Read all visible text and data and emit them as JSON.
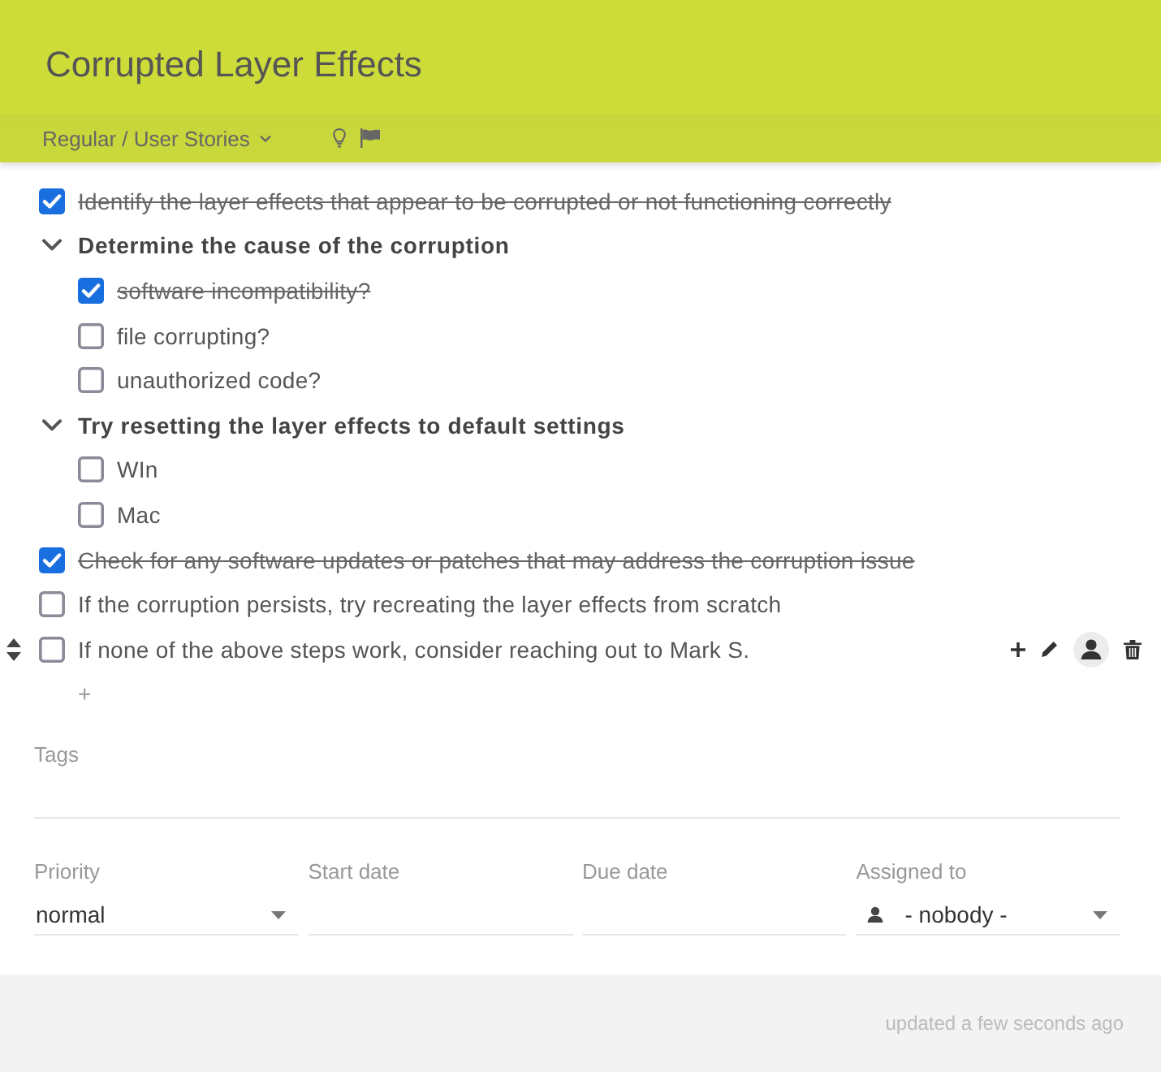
{
  "header": {
    "title": "Corrupted Layer Effects",
    "project": "Regular / User Stories"
  },
  "checklist": [
    {
      "kind": "item",
      "label": "Identify the layer effects that appear to be corrupted or not functioning correctly",
      "checked": true,
      "hovered": false
    },
    {
      "kind": "group",
      "label": "Determine the cause of the corruption",
      "expanded": true,
      "hovered": false,
      "children": [
        {
          "kind": "item",
          "label": "software incompatibility?",
          "checked": true,
          "hovered": false
        },
        {
          "kind": "item",
          "label": "file corrupting?",
          "checked": false,
          "hovered": false
        },
        {
          "kind": "item",
          "label": "unauthorized code?",
          "checked": false,
          "hovered": false
        }
      ]
    },
    {
      "kind": "group",
      "label": "Try resetting the layer effects to default settings",
      "expanded": true,
      "hovered": false,
      "children": [
        {
          "kind": "item",
          "label": "WIn",
          "checked": false,
          "hovered": false
        },
        {
          "kind": "item",
          "label": "Mac",
          "checked": false,
          "hovered": false
        }
      ]
    },
    {
      "kind": "item",
      "label": "Check for any software updates or patches that may address the corruption issue",
      "checked": true,
      "hovered": false
    },
    {
      "kind": "item",
      "label": "If the corruption persists, try recreating the layer effects from scratch",
      "checked": false,
      "hovered": false
    },
    {
      "kind": "item",
      "label": "If none of the above steps work, consider reaching out to Mark S.",
      "checked": false,
      "hovered": true
    }
  ],
  "add_item": "+",
  "tags": {
    "label": "Tags"
  },
  "fields": [
    {
      "kind": "select",
      "label": "Priority",
      "value": "normal"
    },
    {
      "kind": "date",
      "label": "Start date"
    },
    {
      "kind": "date",
      "label": "Due date"
    },
    {
      "kind": "user",
      "label": "Assigned to",
      "value": "- nobody -"
    }
  ],
  "footer": {
    "updated": "updated a few seconds ago"
  }
}
